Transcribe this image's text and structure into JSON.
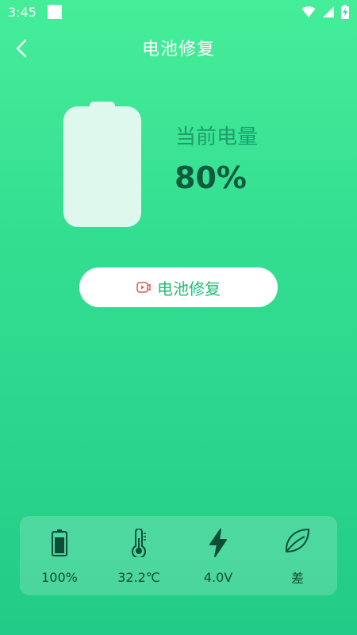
{
  "status_bar": {
    "time": "3:45",
    "icons": [
      "notification-square-icon",
      "wifi-icon",
      "signal-icon",
      "battery-charging-icon"
    ]
  },
  "header": {
    "back_icon": "chevron-left-icon",
    "title": "电池修复"
  },
  "battery": {
    "charge_label": "当前电量",
    "charge_value": "80%"
  },
  "repair_button": {
    "icon": "video-icon",
    "label": "电池修复"
  },
  "info": [
    {
      "icon": "battery-icon",
      "value": "100%"
    },
    {
      "icon": "thermometer-icon",
      "value": "32.2℃"
    },
    {
      "icon": "lightning-icon",
      "value": "4.0V"
    },
    {
      "icon": "leaf-icon",
      "value": "差"
    }
  ],
  "colors": {
    "background_top": "#44ee99",
    "background_bottom": "#22cc88",
    "button_text": "#21bb78",
    "dark_text": "#0d5a3e"
  }
}
